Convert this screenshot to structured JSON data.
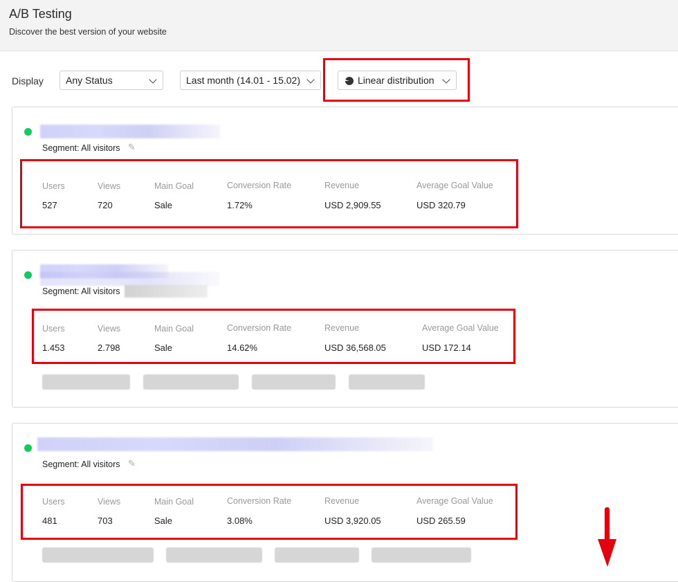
{
  "header": {
    "title": "A/B Testing",
    "subtitle": "Discover the best version of your website"
  },
  "filters": {
    "display_label": "Display",
    "status": "Any Status",
    "date_range": "Last month (14.01 - 15.02)",
    "distribution": "Linear distribution"
  },
  "metric_labels": {
    "users": "Users",
    "views": "Views",
    "main_goal": "Main Goal",
    "conversion_rate": "Conversion Rate",
    "revenue": "Revenue",
    "avg_goal_value": "Average Goal Value"
  },
  "tests": [
    {
      "segment": "Segment: All visitors",
      "users": "527",
      "views": "720",
      "main_goal": "Sale",
      "conversion_rate": "1.72%",
      "revenue": "USD 2,909.55",
      "avg_goal_value": "USD 320.79"
    },
    {
      "segment": "Segment: All visitors",
      "users": "1.453",
      "views": "2.798",
      "main_goal": "Sale",
      "conversion_rate": "14.62%",
      "revenue": "USD 36,568.05",
      "avg_goal_value": "USD 172.14"
    },
    {
      "segment": "Segment: All visitors",
      "users": "481",
      "views": "703",
      "main_goal": "Sale",
      "conversion_rate": "3.08%",
      "revenue": "USD 3,920.05",
      "avg_goal_value": "USD 265.59"
    }
  ],
  "colors": {
    "status_active": "#10cc5f",
    "highlight": "#e4000f"
  },
  "icons": {
    "distribution": "pie-chart-icon",
    "dropdown": "chevron-down-icon",
    "edit": "pencil-icon",
    "scroll_hint": "arrow-down-icon"
  }
}
